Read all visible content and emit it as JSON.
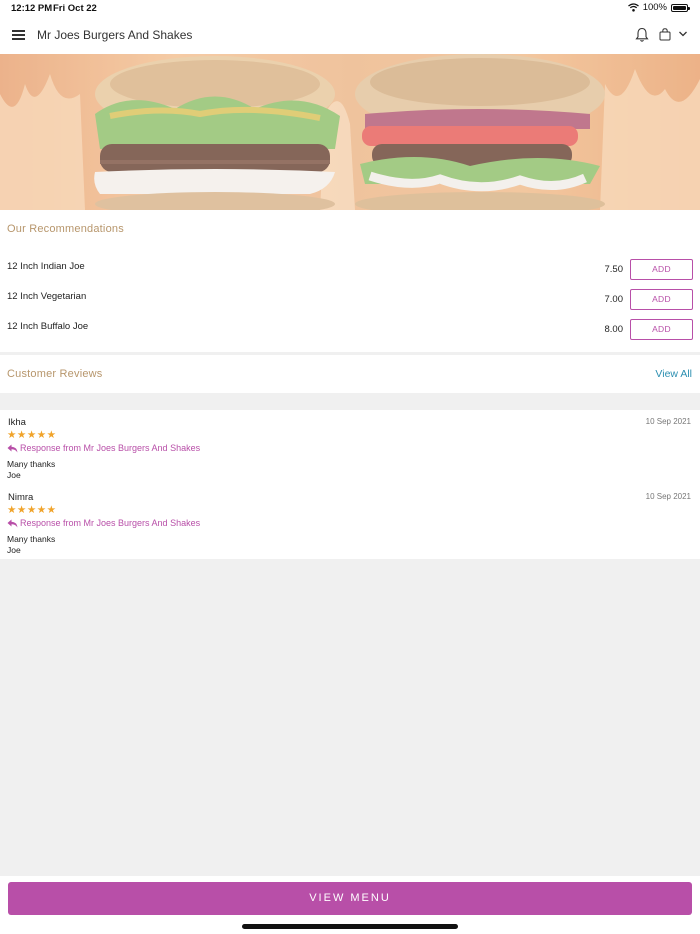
{
  "status_bar": {
    "time": "12:12 PM",
    "date": "Fri Oct 22",
    "battery": "100%",
    "icons": [
      "wifi-icon",
      "battery-icon"
    ]
  },
  "header": {
    "title": "Mr Joes Burgers And Shakes",
    "icons": [
      "menu-icon",
      "bell-icon",
      "bag-icon",
      "chevron-down-icon"
    ]
  },
  "hero": {
    "image": "burgers-on-fire-banner"
  },
  "recommendations": {
    "title": "Our Recommendations",
    "items": [
      {
        "name": "12 Inch Indian Joe",
        "price": "7.50",
        "button": "ADD"
      },
      {
        "name": "12 Inch Vegetarian",
        "price": "7.00",
        "button": "ADD"
      },
      {
        "name": "12 Inch Buffalo Joe",
        "price": "8.00",
        "button": "ADD"
      }
    ]
  },
  "reviews": {
    "title": "Customer Reviews",
    "view_all": "View All",
    "items": [
      {
        "name": "Ikha",
        "date": "10 Sep 2021",
        "stars": "★★★★★",
        "rating": 5,
        "response_label": "Response from Mr Joes Burgers And Shakes",
        "message_line1": "Many thanks",
        "message_line2": "Joe"
      },
      {
        "name": "Nimra",
        "date": "10 Sep 2021",
        "stars": "★★★★★",
        "rating": 5,
        "response_label": "Response from Mr Joes Burgers And Shakes",
        "message_line1": "Many thanks",
        "message_line2": "Joe"
      }
    ]
  },
  "footer": {
    "view_menu_label": "VIEW MENU"
  },
  "colors": {
    "accent": "#b84fa8",
    "section_title": "#b7966c",
    "link": "#2c8fb1",
    "stars": "#f0a32a",
    "background": "#f0f0f0"
  }
}
